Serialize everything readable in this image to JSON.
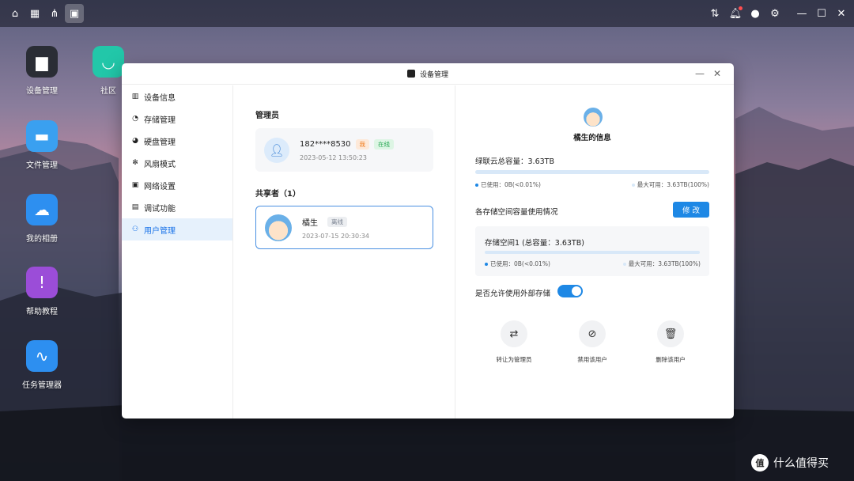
{
  "topbar": {
    "left_icons": [
      "home-icon",
      "apps-grid-icon",
      "network-icon",
      "device-app-icon"
    ],
    "right_icons": [
      "sort-icon",
      "bell-icon",
      "user-icon",
      "settings-icon",
      "minimize-icon",
      "maximize-icon",
      "close-icon"
    ]
  },
  "desktop": {
    "icons": [
      {
        "label": "设备管理",
        "icon": "device-icon",
        "color": "#2a2d35"
      },
      {
        "label": "社区",
        "icon": "community-icon",
        "color": "#22c7a9"
      },
      {
        "label": "文件管理",
        "icon": "folder-icon",
        "color": "#3aa0f0"
      },
      {
        "label": "我的相册",
        "icon": "photo-icon",
        "color": "#2d8ff0"
      },
      {
        "label": "帮助教程",
        "icon": "help-icon",
        "color": "#9b4dd8"
      },
      {
        "label": "任务管理器",
        "icon": "task-icon",
        "color": "#2d8ff0"
      }
    ]
  },
  "window": {
    "title": "设备管理",
    "sidebar": {
      "items": [
        {
          "label": "设备信息",
          "icon": "info-icon",
          "active": false
        },
        {
          "label": "存储管理",
          "icon": "pie-icon",
          "active": false
        },
        {
          "label": "硬盘管理",
          "icon": "disk-icon",
          "active": false
        },
        {
          "label": "风扇模式",
          "icon": "fan-icon",
          "active": false
        },
        {
          "label": "网络设置",
          "icon": "ip-icon",
          "active": false
        },
        {
          "label": "调试功能",
          "icon": "terminal-icon",
          "active": false
        },
        {
          "label": "用户管理",
          "icon": "users-icon",
          "active": true
        }
      ]
    },
    "admin": {
      "section_title": "管理员",
      "name": "182****8530",
      "badge_me": "我",
      "badge_status": "在线",
      "time": "2023-05-12 13:50:23"
    },
    "sharer": {
      "section_title": "共享者（1）",
      "name": "橘生",
      "badge_status": "离线",
      "time": "2023-07-15 20:30:34"
    },
    "detail": {
      "name": "橘生的信息",
      "total_label": "绿联云总容量：3.63TB",
      "used": "已使用：0B(<0.01%)",
      "max": "最大可用：3.63TB(100%)",
      "usage_label": "各存储空间容量使用情况",
      "edit_button": "修 改",
      "space_title": "存储空间1 (总容量：3.63TB)",
      "space_used": "已使用：0B(<0.01%)",
      "space_max": "最大可用：3.63TB(100%)",
      "external_label": "是否允许使用外部存储",
      "external_enabled": true,
      "actions": [
        {
          "label": "转让为管理员",
          "icon": "transfer-icon"
        },
        {
          "label": "禁用该用户",
          "icon": "ban-icon"
        },
        {
          "label": "删除该用户",
          "icon": "trash-icon"
        }
      ]
    }
  },
  "watermark": {
    "text": "什么值得买",
    "logo": "值"
  },
  "colors": {
    "accent": "#1e88e5",
    "sidebar_active_bg": "#e6f1fc"
  }
}
